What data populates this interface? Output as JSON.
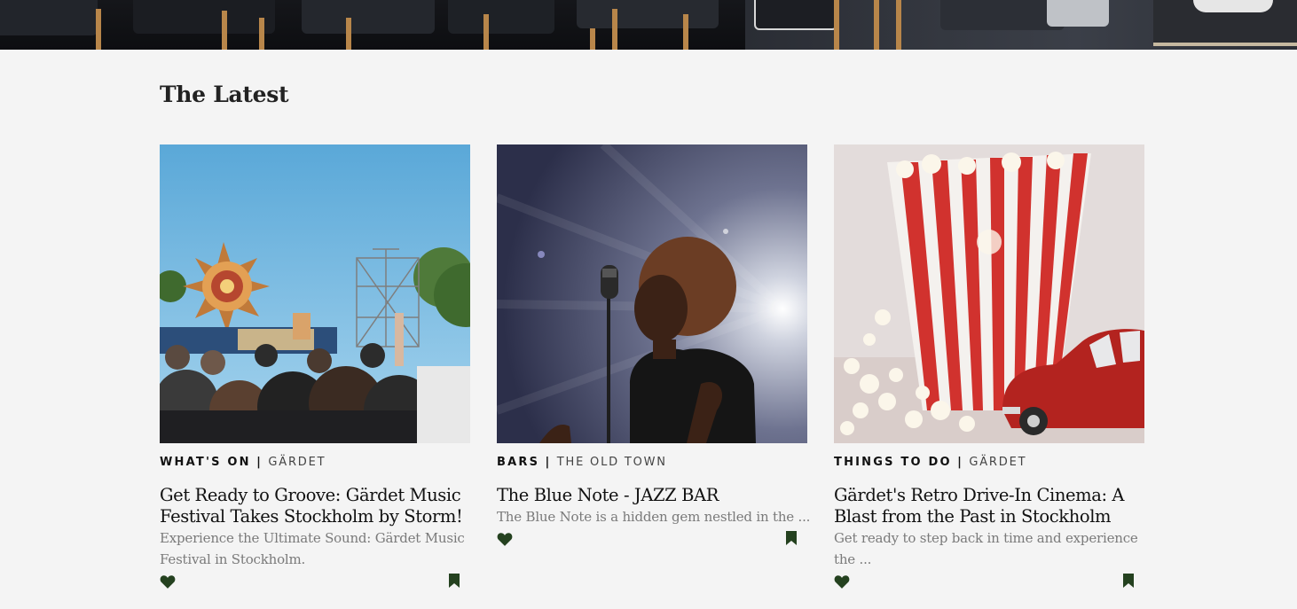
{
  "section": {
    "title": "The Latest"
  },
  "cards": [
    {
      "category": "WHAT'S ON",
      "separator": "|",
      "location": "GÄRDET",
      "title": "Get Ready to Groove: Gärdet Music Festival Takes Stockholm by Storm!",
      "excerpt": "Experience the Ultimate Sound: Gärdet Music Festival in Stockholm.",
      "image": "festival-crowd-stage"
    },
    {
      "category": "BARS",
      "separator": "|",
      "location": "THE OLD TOWN",
      "title": "The Blue Note - JAZZ BAR",
      "excerpt": "The Blue Note is a hidden gem nestled in the ...",
      "image": "jazz-singer-microphone"
    },
    {
      "category": "THINGS TO DO",
      "separator": "|",
      "location": "GÄRDET",
      "title": "Gärdet's Retro Drive-In Cinema: A Blast from the Past in Stockholm",
      "excerpt": "Get ready to step back in time and experience the ...",
      "image": "popcorn-toy-car"
    }
  ],
  "icons": {
    "like": "heart-icon",
    "save": "bookmark-icon"
  },
  "colors": {
    "icon": "#24411f",
    "background": "#f4f4f4",
    "text": "#111111",
    "muted": "#7a7a7a"
  }
}
